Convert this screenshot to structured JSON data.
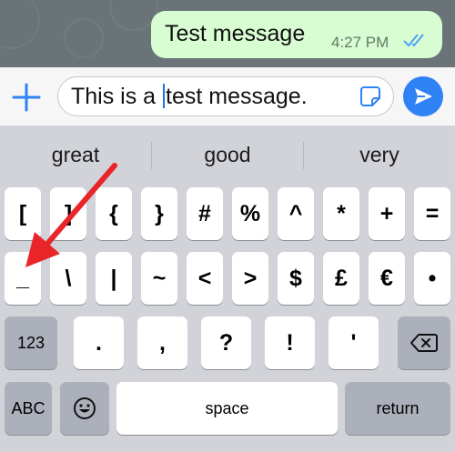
{
  "chat": {
    "message_text": "Test message",
    "message_time": "4:27 PM",
    "accent": "#2f82f6"
  },
  "compose": {
    "text_before_caret": "This is a ",
    "text_after_caret": "test message."
  },
  "suggestions": [
    "great",
    "good",
    "very"
  ],
  "keyboard": {
    "row1": [
      "[",
      "]",
      "{",
      "}",
      "#",
      "%",
      "^",
      "*",
      "+",
      "="
    ],
    "row2": [
      "_",
      "\\",
      "|",
      "~",
      "<",
      ">",
      "$",
      "£",
      "€",
      "•"
    ],
    "row3_mode": "123",
    "row3": [
      ".",
      ",",
      "?",
      "!",
      "'"
    ],
    "row4_mode": "ABC",
    "space": "space",
    "return": "return"
  }
}
